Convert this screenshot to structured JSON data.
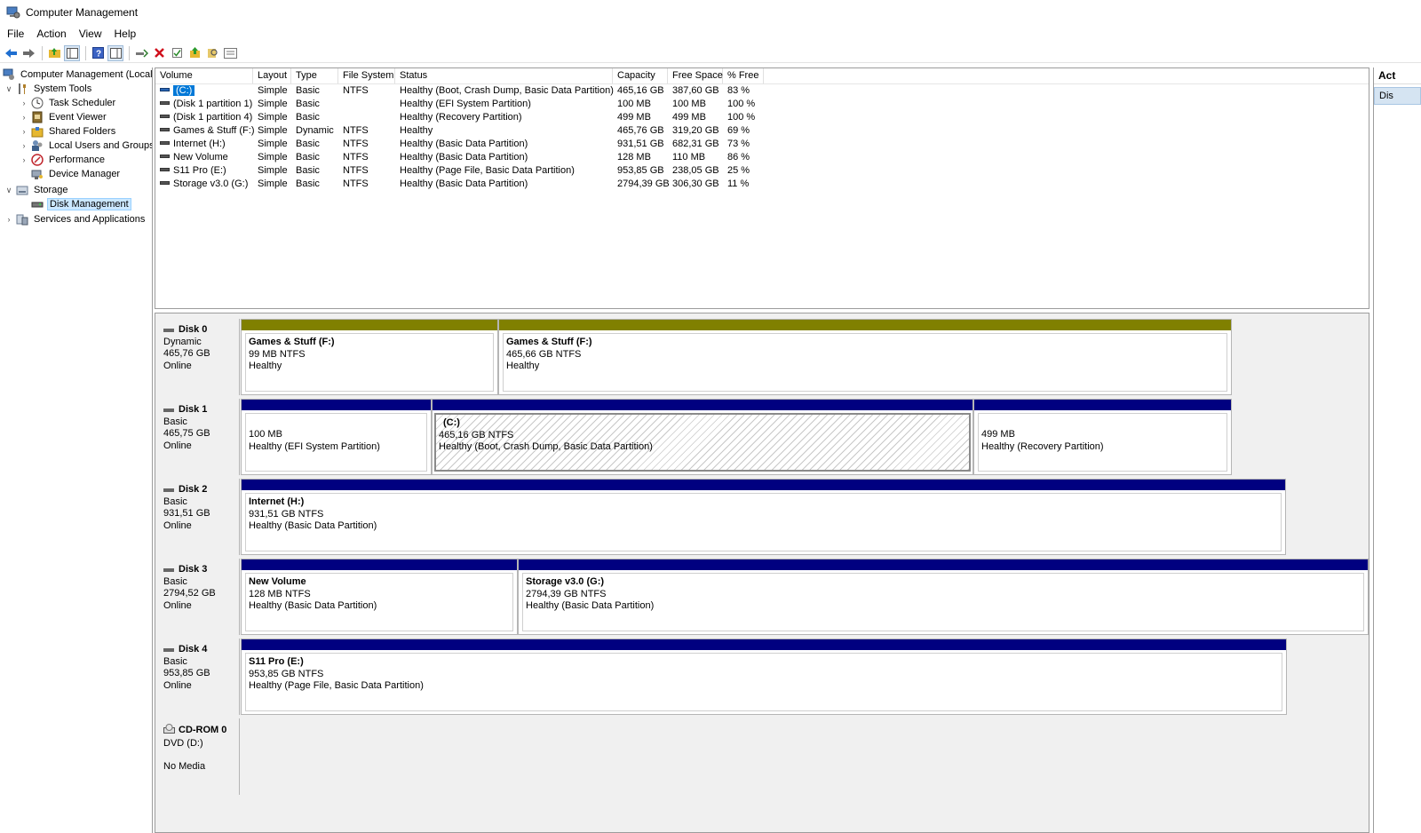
{
  "window": {
    "title": "Computer Management"
  },
  "menu": [
    "File",
    "Action",
    "View",
    "Help"
  ],
  "toolbar": {
    "icons": [
      "back-icon",
      "forward-icon",
      "up-folder-icon",
      "show-hide-tree-icon",
      "help-icon",
      "show-action-pane-icon",
      "connect-icon",
      "delete-icon",
      "properties-icon",
      "refresh-up-icon",
      "search-icon",
      "export-list-icon"
    ],
    "colors": {
      "back": "#1f6fd0",
      "delete": "#d0101c",
      "folder": "#e6b830"
    }
  },
  "tree": {
    "root": "Computer Management (Local",
    "system_tools": "System Tools",
    "task_scheduler": "Task Scheduler",
    "event_viewer": "Event Viewer",
    "shared_folders": "Shared Folders",
    "local_users": "Local Users and Groups",
    "performance": "Performance",
    "device_manager": "Device Manager",
    "storage": "Storage",
    "disk_management": "Disk Management",
    "services": "Services and Applications"
  },
  "volume_list": {
    "columns": [
      "Volume",
      "Layout",
      "Type",
      "File System",
      "Status",
      "Capacity",
      "Free Space",
      "% Free"
    ],
    "rows": [
      [
        "(C:)",
        "Simple",
        "Basic",
        "NTFS",
        "Healthy (Boot, Crash Dump, Basic Data Partition)",
        "465,16 GB",
        "387,60 GB",
        "83 %"
      ],
      [
        "(Disk 1 partition 1)",
        "Simple",
        "Basic",
        "",
        "Healthy (EFI System Partition)",
        "100 MB",
        "100 MB",
        "100 %"
      ],
      [
        "(Disk 1 partition 4)",
        "Simple",
        "Basic",
        "",
        "Healthy (Recovery Partition)",
        "499 MB",
        "499 MB",
        "100 %"
      ],
      [
        "Games & Stuff (F:)",
        "Simple",
        "Dynamic",
        "NTFS",
        "Healthy",
        "465,76 GB",
        "319,20 GB",
        "69 %"
      ],
      [
        "Internet (H:)",
        "Simple",
        "Basic",
        "NTFS",
        "Healthy (Basic Data Partition)",
        "931,51 GB",
        "682,31 GB",
        "73 %"
      ],
      [
        "New Volume",
        "Simple",
        "Basic",
        "NTFS",
        "Healthy (Basic Data Partition)",
        "128 MB",
        "110 MB",
        "86 %"
      ],
      [
        "S11 Pro (E:)",
        "Simple",
        "Basic",
        "NTFS",
        "Healthy (Page File, Basic Data Partition)",
        "953,85 GB",
        "238,05 GB",
        "25 %"
      ],
      [
        "Storage v3.0 (G:)",
        "Simple",
        "Basic",
        "NTFS",
        "Healthy (Basic Data Partition)",
        "2794,39 GB",
        "306,30 GB",
        "11 %"
      ]
    ]
  },
  "disks": {
    "d0": {
      "name": "Disk 0",
      "type": "Dynamic",
      "size": "465,76 GB",
      "status": "Online",
      "p1": {
        "name": "Games & Stuff  (F:)",
        "size": "99 MB NTFS",
        "status": "Healthy"
      },
      "p2": {
        "name": "Games & Stuff  (F:)",
        "size": "465,66 GB NTFS",
        "status": "Healthy"
      }
    },
    "d1": {
      "name": "Disk 1",
      "type": "Basic",
      "size": "465,75 GB",
      "status": "Online",
      "p1": {
        "size": "100 MB",
        "status": "Healthy (EFI System Partition)"
      },
      "p2": {
        "name": "(C:)",
        "size": "465,16 GB NTFS",
        "status": "Healthy (Boot, Crash Dump, Basic Data Partition)"
      },
      "p3": {
        "size": "499 MB",
        "status": "Healthy (Recovery Partition)"
      }
    },
    "d2": {
      "name": "Disk 2",
      "type": "Basic",
      "size": "931,51 GB",
      "status": "Online",
      "p1": {
        "name": "Internet  (H:)",
        "size": "931,51 GB NTFS",
        "status": "Healthy (Basic Data Partition)"
      }
    },
    "d3": {
      "name": "Disk 3",
      "type": "Basic",
      "size": "2794,52 GB",
      "status": "Online",
      "p1": {
        "name": "New Volume",
        "size": "128 MB NTFS",
        "status": "Healthy (Basic Data Partition)"
      },
      "p2": {
        "name": "Storage v3.0  (G:)",
        "size": "2794,39 GB NTFS",
        "status": "Healthy (Basic Data Partition)"
      }
    },
    "d4": {
      "name": "Disk 4",
      "type": "Basic",
      "size": "953,85 GB",
      "status": "Online",
      "p1": {
        "name": "S11 Pro  (E:)",
        "size": "953,85 GB NTFS",
        "status": "Healthy (Page File, Basic Data Partition)"
      }
    },
    "cd": {
      "name": "CD-ROM 0",
      "type": "DVD (D:)",
      "status": "No Media"
    }
  },
  "colors": {
    "dynamic_bar": "#808000",
    "basic_bar": "#000080",
    "selection": "#0078d7"
  },
  "actions": {
    "title": "Act",
    "item": "Dis"
  }
}
